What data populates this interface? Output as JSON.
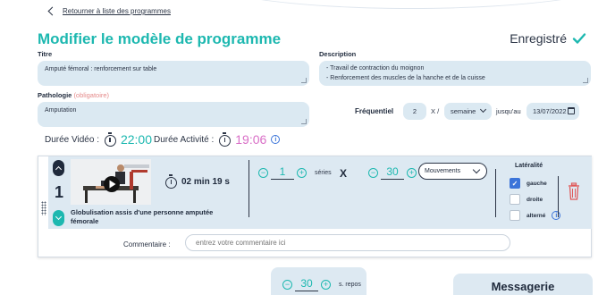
{
  "back": {
    "label": "Retourner à liste des programmes"
  },
  "header": {
    "title": "Modifier le modèle de programme",
    "status": "Enregistré"
  },
  "form": {
    "titre_label": "Titre",
    "titre_value": "Amputé fémoral : renforcement sur table",
    "description_label": "Description",
    "description_lines": [
      "- Travail de contraction du moignon",
      "- Renforcement des muscles de la hanche et de la cuisse"
    ],
    "pathologie_label": "Pathologie",
    "pathologie_optional": "(obligatoire)",
    "pathologie_value": "Amputation"
  },
  "frequency": {
    "label": "Fréquentiel",
    "count": "2",
    "per": "X /",
    "period": "semaine",
    "until_label": "jusqu'au",
    "until_date": "13/07/2022"
  },
  "durations": {
    "video_label": "Durée Vidéo :",
    "video_value": "22:00",
    "activity_label": "Durée Activité :",
    "activity_value": "19:06",
    "video_color": "#1db8b0",
    "activity_color": "#d96fc7"
  },
  "exercise": {
    "index": "1",
    "title": "Globulisation assis d'une personne amputée fémorale",
    "duration": "02 min 19 s",
    "series_value": "1",
    "series_label": "séries",
    "times": "X",
    "reps_value": "30",
    "unit_select": "Mouvements",
    "laterality": {
      "title": "Latéralité",
      "options": [
        {
          "label": "gauche",
          "checked": true
        },
        {
          "label": "droite",
          "checked": false
        },
        {
          "label": "alterné",
          "checked": false
        }
      ]
    },
    "comment_label": "Commentaire :",
    "comment_placeholder": "entrez votre commentaire ici"
  },
  "rest": {
    "value": "30",
    "label": "s. repos"
  },
  "messaging": {
    "title": "Messagerie"
  },
  "colors": {
    "accent": "#1db8b0",
    "field_bg": "#dbe9f2",
    "blue": "#3b74d9",
    "delete": "#e05a5a"
  }
}
